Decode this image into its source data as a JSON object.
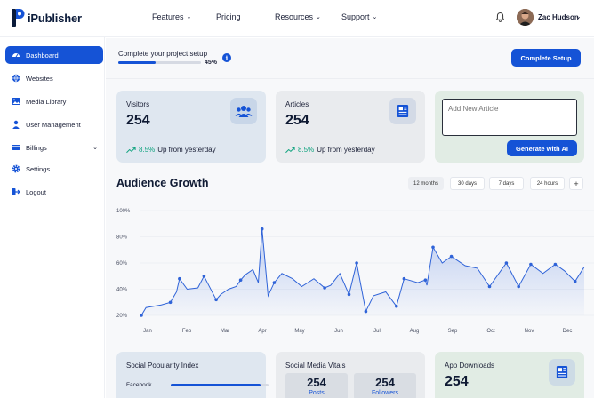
{
  "header": {
    "brand": "iPublisher",
    "nav": [
      {
        "label": "Features",
        "chevron": true
      },
      {
        "label": "Pricing",
        "chevron": false
      },
      {
        "label": "Resources",
        "chevron": true
      },
      {
        "label": "Support",
        "chevron": true
      }
    ],
    "user_name": "Zac Hudson"
  },
  "sidebar": {
    "items": [
      {
        "label": "Dashboard",
        "icon": "dashboard-icon",
        "active": true
      },
      {
        "label": "Websites",
        "icon": "globe-icon"
      },
      {
        "label": "Media Library",
        "icon": "image-icon"
      },
      {
        "label": "User Management",
        "icon": "user-icon"
      },
      {
        "label": "Billings",
        "icon": "billing-icon",
        "chevron": true
      },
      {
        "label": "Settings",
        "icon": "gear-icon"
      },
      {
        "label": "Logout",
        "icon": "logout-icon"
      }
    ]
  },
  "setup": {
    "title": "Complete your project setup",
    "progress": 45,
    "progress_label": "45%",
    "button": "Complete Setup"
  },
  "stats": {
    "visitors": {
      "label": "Visitors",
      "value": "254",
      "trend_pct": "8.5%",
      "trend_text": "Up from yesterday"
    },
    "articles": {
      "label": "Articles",
      "value": "254",
      "trend_pct": "8.5%",
      "trend_text": "Up from yesterday"
    },
    "new_article": {
      "placeholder": "Add New Article",
      "button": "Generate with AI"
    }
  },
  "audience": {
    "title": "Audience Growth",
    "ranges": [
      "12 months",
      "30 days",
      "7 days",
      "24 hours"
    ],
    "active_range": "12 months",
    "add_label": "+"
  },
  "chart_data": {
    "type": "area",
    "categories": [
      "Jan",
      "Feb",
      "Mar",
      "Apr",
      "May",
      "Jun",
      "Jul",
      "Aug",
      "Sep",
      "Oct",
      "Nov",
      "Dec"
    ],
    "yticks": [
      "100%",
      "80%",
      "60%",
      "40%",
      "20%"
    ],
    "ylim": [
      20,
      100
    ],
    "x_range": [
      0,
      11
    ],
    "grid": true,
    "color": "#2f63d8",
    "series": [
      {
        "values": [
          [
            -0.15,
            20
          ],
          [
            0.0,
            26
          ],
          [
            0.5,
            28
          ],
          [
            0.8,
            30
          ],
          [
            1.0,
            38
          ],
          [
            1.1,
            48
          ],
          [
            1.35,
            40
          ],
          [
            1.7,
            41
          ],
          [
            1.9,
            50
          ],
          [
            2.3,
            32
          ],
          [
            2.45,
            36
          ],
          [
            2.7,
            40
          ],
          [
            2.95,
            42
          ],
          [
            3.1,
            47
          ],
          [
            3.25,
            51
          ],
          [
            3.5,
            55
          ],
          [
            3.68,
            45
          ],
          [
            3.8,
            86
          ],
          [
            4.0,
            35
          ],
          [
            4.2,
            45
          ],
          [
            4.45,
            52
          ],
          [
            4.8,
            48
          ],
          [
            5.1,
            42
          ],
          [
            5.5,
            48
          ],
          [
            5.85,
            41
          ],
          [
            6.05,
            43
          ],
          [
            6.35,
            52
          ],
          [
            6.65,
            36
          ],
          [
            6.9,
            60
          ],
          [
            7.2,
            23
          ],
          [
            7.45,
            35
          ],
          [
            7.85,
            38
          ],
          [
            8.2,
            27
          ],
          [
            8.45,
            48
          ],
          [
            8.9,
            45
          ],
          [
            9.15,
            47
          ],
          [
            9.2,
            43
          ],
          [
            9.4,
            72
          ],
          [
            9.7,
            60
          ],
          [
            10.0,
            65
          ],
          [
            10.45,
            58
          ],
          [
            10.85,
            56
          ],
          [
            11.25,
            42
          ],
          [
            11.8,
            60
          ],
          [
            12.2,
            42
          ],
          [
            12.6,
            59
          ],
          [
            13.0,
            52
          ],
          [
            13.4,
            59
          ],
          [
            13.7,
            54
          ],
          [
            14.05,
            46
          ],
          [
            14.35,
            57
          ]
        ]
      }
    ]
  },
  "bottom": {
    "social": {
      "title": "Social Popularity Index",
      "items": [
        {
          "label": "Facebook",
          "value": 0.92
        }
      ]
    },
    "vitals": {
      "title": "Social Media Vitals",
      "posts_value": "254",
      "posts_label": "Posts",
      "followers_value": "254",
      "followers_label": "Followers"
    },
    "downloads": {
      "title": "App Downloads",
      "value": "254"
    }
  }
}
